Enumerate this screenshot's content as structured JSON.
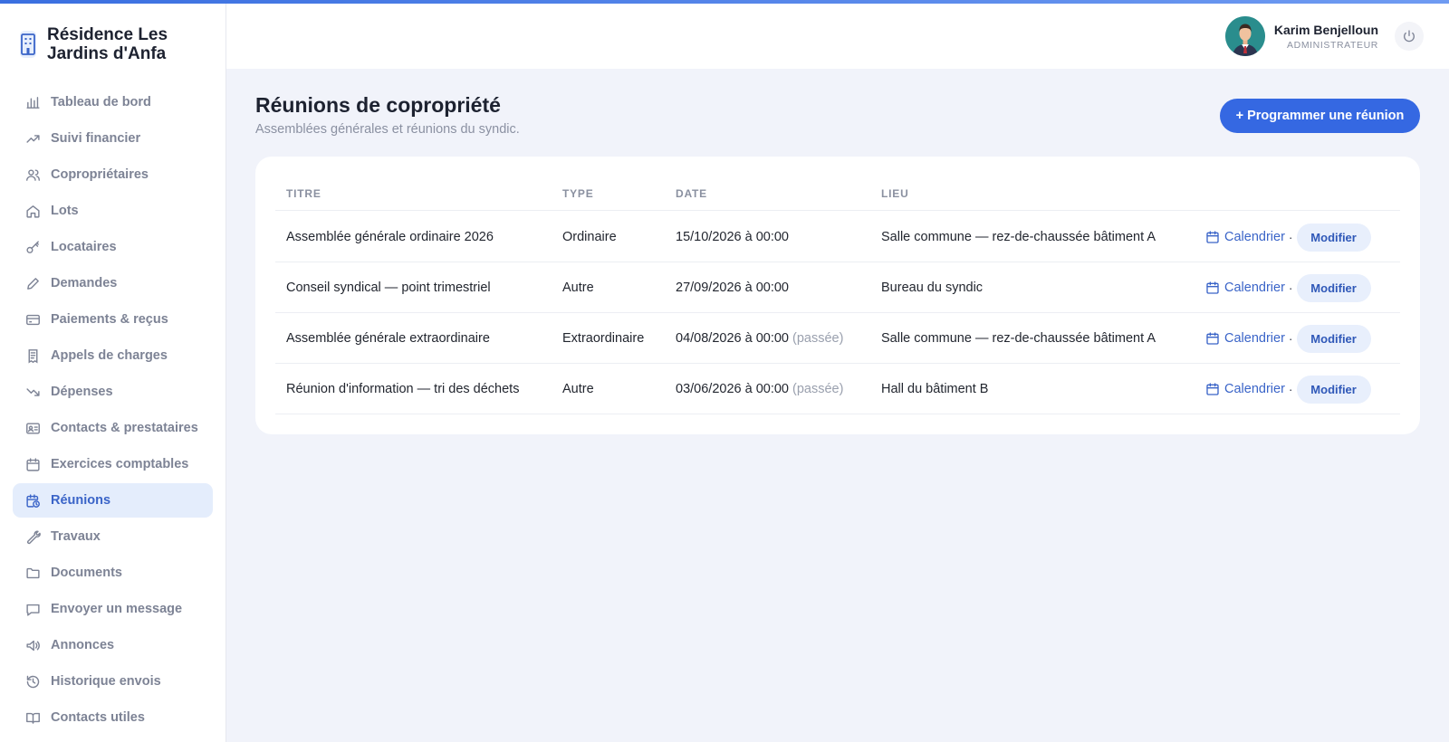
{
  "brand": {
    "name": "Résidence Les Jardins d'Anfa",
    "icon": "building-icon"
  },
  "sidebar": {
    "items": [
      {
        "label": "Tableau de bord",
        "icon": "bar-chart-icon"
      },
      {
        "label": "Suivi financier",
        "icon": "trend-up-icon"
      },
      {
        "label": "Copropriétaires",
        "icon": "users-icon"
      },
      {
        "label": "Lots",
        "icon": "home-icon"
      },
      {
        "label": "Locataires",
        "icon": "key-icon"
      },
      {
        "label": "Demandes",
        "icon": "pencil-icon"
      },
      {
        "label": "Paiements & reçus",
        "icon": "credit-card-icon"
      },
      {
        "label": "Appels de charges",
        "icon": "receipt-icon"
      },
      {
        "label": "Dépenses",
        "icon": "trend-down-icon"
      },
      {
        "label": "Contacts & prestataires",
        "icon": "contact-card-icon"
      },
      {
        "label": "Exercices comptables",
        "icon": "calendar-icon"
      },
      {
        "label": "Réunions",
        "icon": "calendar-clock-icon",
        "active": true
      },
      {
        "label": "Travaux",
        "icon": "wrench-icon"
      },
      {
        "label": "Documents",
        "icon": "folder-icon"
      },
      {
        "label": "Envoyer un message",
        "icon": "message-icon"
      },
      {
        "label": "Annonces",
        "icon": "megaphone-icon"
      },
      {
        "label": "Historique envois",
        "icon": "history-icon"
      },
      {
        "label": "Contacts utiles",
        "icon": "book-icon"
      }
    ]
  },
  "header": {
    "user_name": "Karim Benjelloun",
    "user_role": "ADMINISTRATEUR",
    "power_icon": "power-icon"
  },
  "page": {
    "title": "Réunions de copropriété",
    "subtitle": "Assemblées générales et réunions du syndic.",
    "add_button": "+ Programmer une réunion"
  },
  "table": {
    "columns": [
      "TITRE",
      "TYPE",
      "DATE",
      "LIEU"
    ],
    "rows": [
      {
        "titre": "Assemblée générale ordinaire 2026",
        "type": "Ordinaire",
        "date": "15/10/2026 à 00:00",
        "past": "",
        "lieu": "Salle commune — rez-de-chaussée bâtiment A"
      },
      {
        "titre": "Conseil syndical — point trimestriel",
        "type": "Autre",
        "date": "27/09/2026 à 00:00",
        "past": "",
        "lieu": "Bureau du syndic"
      },
      {
        "titre": "Assemblée générale extraordinaire",
        "type": "Extraordinaire",
        "date": "04/08/2026 à 00:00",
        "past": "(passée)",
        "lieu": "Salle commune — rez-de-chaussée bâtiment A"
      },
      {
        "titre": "Réunion d'information — tri des déchets",
        "type": "Autre",
        "date": "03/06/2026 à 00:00",
        "past": "(passée)",
        "lieu": "Hall du bâtiment B"
      }
    ],
    "calendar_label": "Calendrier",
    "separator": "·",
    "modify_label": "Modifier"
  },
  "colors": {
    "accent": "#3568e2",
    "active_bg": "#e4edfc",
    "sidebar_text": "#7d8395",
    "link": "#3a64c8"
  }
}
